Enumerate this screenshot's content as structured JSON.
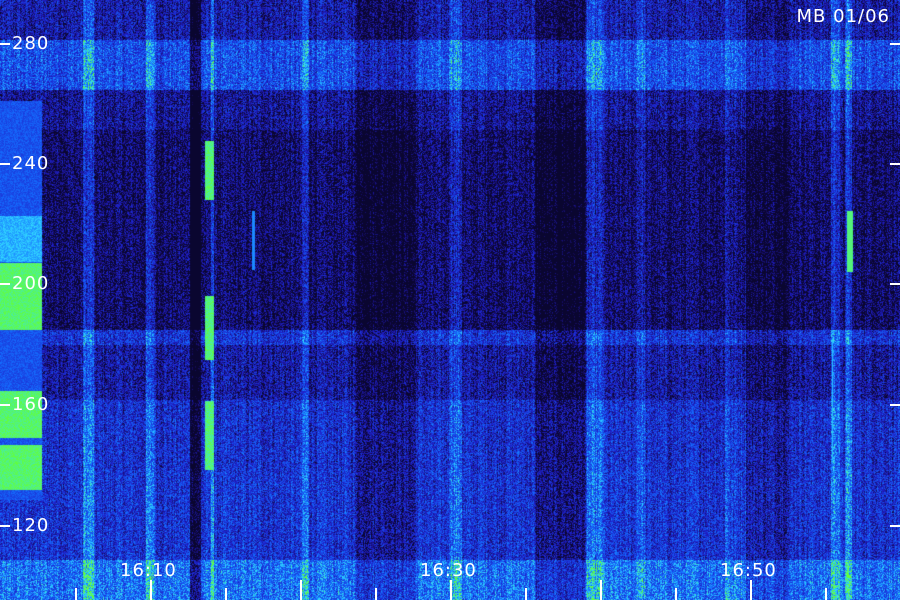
{
  "title": "MB 01/06",
  "y_ticks": [
    {
      "label": "280",
      "value": 280
    },
    {
      "label": "240",
      "value": 240
    },
    {
      "label": "200",
      "value": 200
    },
    {
      "label": "160",
      "value": 160
    },
    {
      "label": "120",
      "value": 120
    }
  ],
  "x_ticks": [
    {
      "label": "16:10"
    },
    {
      "label": "16:30"
    },
    {
      "label": "16:50"
    }
  ],
  "colors": {
    "background": "#0a0630",
    "low": "#1a1a9a",
    "mid": "#2060ff",
    "high": "#30c0ff",
    "peak": "#40ff40",
    "text": "#ffffff"
  }
}
